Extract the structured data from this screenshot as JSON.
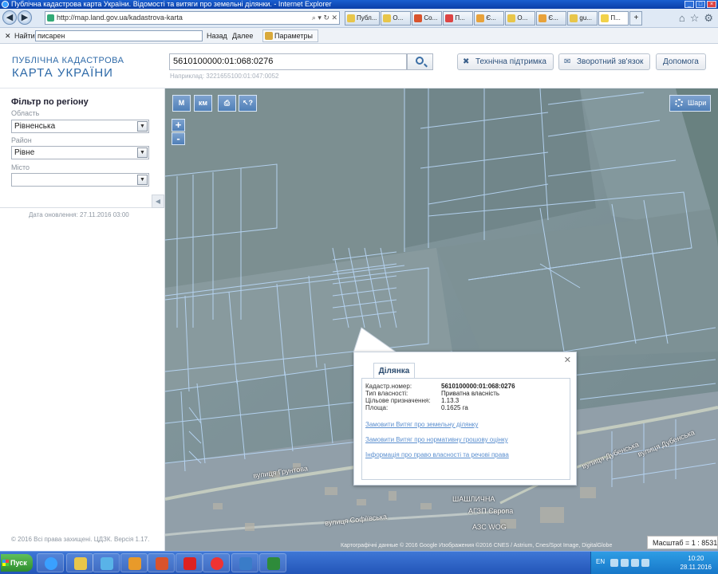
{
  "window": {
    "title": "Публічна кадастрова карта України. Відомості та витяги про земельні ділянки. - Internet Explorer"
  },
  "browser": {
    "url": "http://map.land.gov.ua/kadastrova-karta",
    "tabs": [
      {
        "label": "Публ...",
        "color": "#e8c64a"
      },
      {
        "label": "O...",
        "color": "#e8c64a"
      },
      {
        "label": "Co...",
        "color": "#d9532c"
      },
      {
        "label": "П...",
        "color": "#d44"
      },
      {
        "label": "Є...",
        "color": "#e8a23a"
      },
      {
        "label": "O...",
        "color": "#e8c64a"
      },
      {
        "label": "Є...",
        "color": "#e8a23a"
      },
      {
        "label": "gu...",
        "color": "#e8c64a"
      },
      {
        "label": "П...",
        "color": "#f2d24a"
      }
    ]
  },
  "findbar": {
    "label": "Найти:",
    "query": "писарен",
    "prev": "Назад",
    "next": "Далее",
    "options": "Параметры"
  },
  "site": {
    "logo_line1": "ПУБЛІЧНА КАДАСТРОВА",
    "logo_line2": "КАРТА УКРАЇНИ",
    "search_value": "5610100000:01:068:0276",
    "search_example": "Наприклад: 3221655100:01:047:0052",
    "btn_support": "Технічна підтримка",
    "btn_feedback": "Зворотний зв'язок",
    "btn_help": "Допомога"
  },
  "filter": {
    "title": "Фільтр по регіону",
    "region_label": "Область",
    "region_value": "Рівненська",
    "district_label": "Район",
    "district_value": "Рівне",
    "city_label": "Місто",
    "city_value": "",
    "updated": "Дата оновлення: 27.11.2016 03:00",
    "copyright": "© 2016 Всі права захищені. ЦДЗК. Версія 1.17."
  },
  "map": {
    "tool_m": "M",
    "tool_km": "км",
    "tool_info": "?",
    "zoom_in": "+",
    "zoom_out": "-",
    "layers_label": "Шари",
    "attribution": "Картографічні данные © 2016 Google Изображения ©2016 CNES / Astrium, Cnes/Spot Image, DigitalGlobe",
    "scale_label": "Масштаб = 1 : 8531",
    "labels": {
      "street1": "вулиця Грунтова",
      "street2": "вулиця Софіївська",
      "street3": "вулиця Дубенська",
      "street4": "вулиця Дубенська",
      "poi1": "ШАШЛИЧНА",
      "poi2": "АГЗП Європа",
      "poi3": "АЗС WOG"
    },
    "overlay_color": "#9fc4ec"
  },
  "popup": {
    "tab": "Ділянка",
    "rows": [
      {
        "label": "Кадастр.номер:",
        "value": "5610100000:01:068:0276"
      },
      {
        "label": "Тип власності:",
        "value": "Приватна власність"
      },
      {
        "label": "Цільове призначення:",
        "value": "1.13.3"
      },
      {
        "label": "Площа:",
        "value": "0.1625 га"
      }
    ],
    "links": [
      "Замовити Витяг про земельну ділянку",
      "Замовити Витяг про нормативну грошову оцінку",
      "Інформація про право власності та речові права"
    ]
  },
  "taskbar": {
    "start": "Пуск",
    "lang": "EN",
    "time": "10:20",
    "date": "28.11.2016"
  }
}
